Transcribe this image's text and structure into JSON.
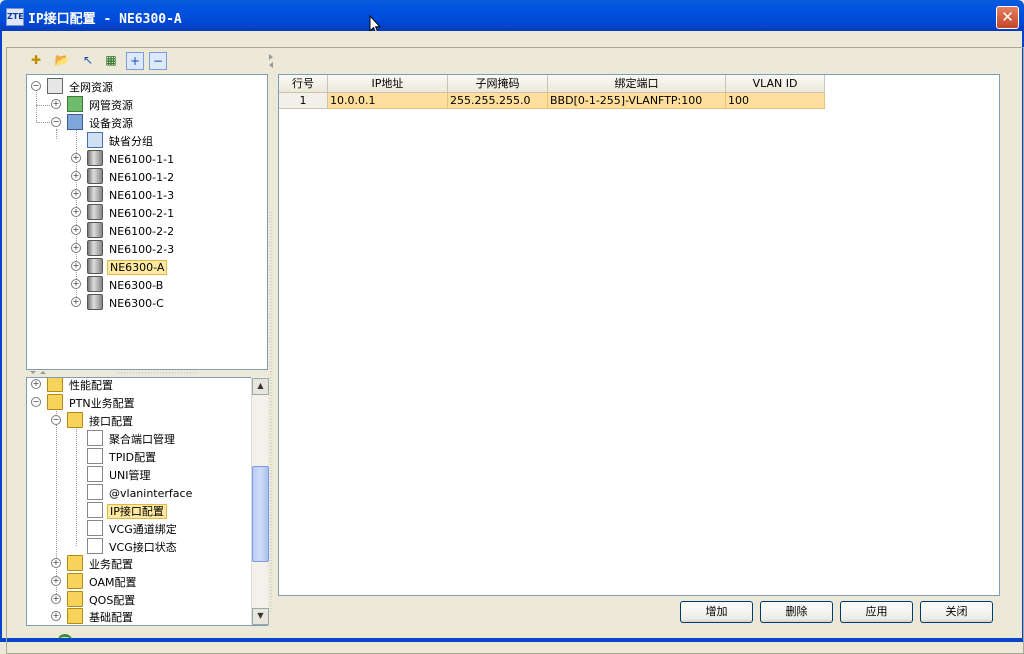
{
  "window": {
    "title": "IP接口配置 - NE6300-A",
    "app_icon_text": "ZTE",
    "close_glyph": "✕"
  },
  "toolbar": {
    "icons": [
      "new-icon",
      "open-folder-icon",
      "pointer-icon",
      "network-card-icon",
      "expand-all-icon",
      "collapse-all-icon"
    ],
    "glyphs": [
      "✚",
      "📂",
      "↖",
      "▦",
      "+",
      "−"
    ]
  },
  "resource_tree": {
    "root": "全网资源",
    "network": "网管资源",
    "device": "设备资源",
    "default_group": "缺省分组",
    "nes": [
      "NE6100-1-1",
      "NE6100-1-2",
      "NE6100-1-3",
      "NE6100-2-1",
      "NE6100-2-2",
      "NE6100-2-3",
      "NE6300-A",
      "NE6300-B",
      "NE6300-C"
    ],
    "selected": "NE6300-A"
  },
  "function_tree": {
    "perf": "性能配置",
    "ptn": "PTN业务配置",
    "iface": "接口配置",
    "iface_items": [
      "聚合端口管理",
      "TPID配置",
      "UNI管理",
      "@vlaninterface",
      "IP接口配置",
      "VCG通道绑定",
      "VCG接口状态"
    ],
    "selected": "IP接口配置",
    "others": [
      "业务配置",
      "OAM配置",
      "QOS配置",
      "基础配置"
    ]
  },
  "table": {
    "headers": [
      "行号",
      "IP地址",
      "子网掩码",
      "绑定端口",
      "VLAN ID"
    ],
    "rows": [
      [
        "1",
        "10.0.0.1",
        "255.255.255.0",
        "BBD[0-1-255]-VLANFTP:100",
        "100"
      ]
    ]
  },
  "buttons": {
    "add": "增加",
    "delete": "删除",
    "apply": "应用",
    "close": "关闭"
  }
}
